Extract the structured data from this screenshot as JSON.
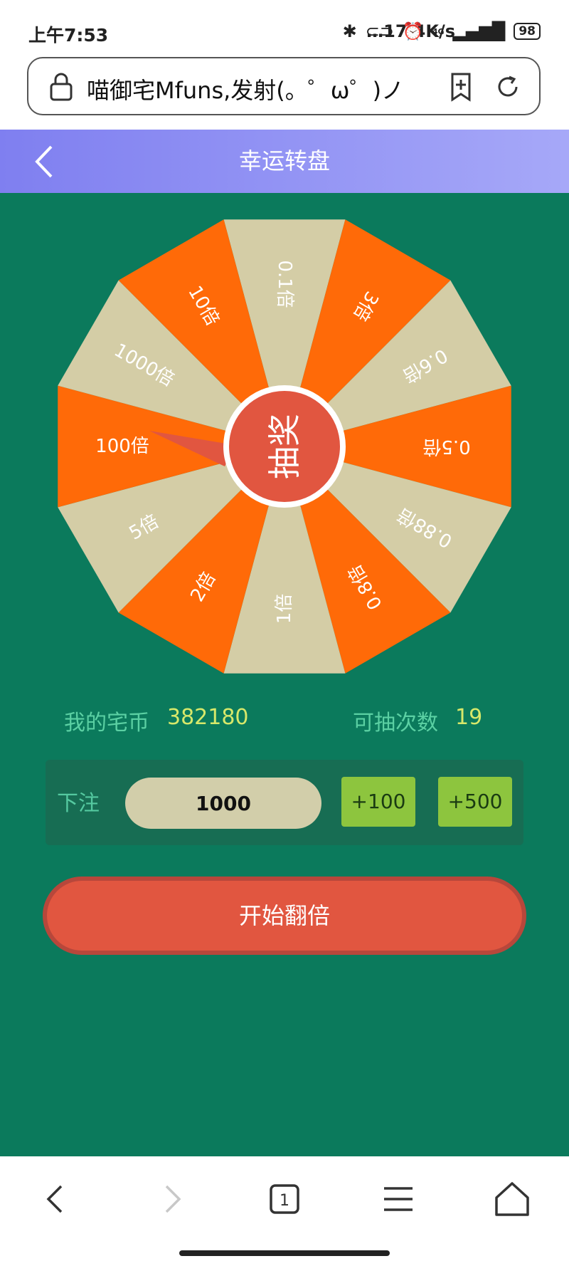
{
  "status_bar": {
    "time": "上午7:53",
    "speed": "…17.4K/s",
    "network": "4G",
    "battery": "98"
  },
  "browser": {
    "url_title": "喵御宅Mfuns,发射(。゜ω゜)ノ"
  },
  "header": {
    "title": "幸运转盘"
  },
  "wheel": {
    "center_label": "抽奖",
    "segments": [
      "0.1倍",
      "3倍",
      "0.6倍",
      "0.5倍",
      "0.88倍",
      "0.8倍",
      "1倍",
      "2倍",
      "5倍",
      "100倍",
      "1000倍",
      "10倍"
    ],
    "colors": {
      "orange": "#ff6a08",
      "beige": "#d4cda6",
      "center": "#e15640",
      "background": "#0b7a5c"
    }
  },
  "stats": {
    "coins_label": "我的宅币",
    "coins_value": "382180",
    "draws_label": "可抽次数",
    "draws_value": "19"
  },
  "bet": {
    "label": "下注",
    "value": "1000",
    "add100": "+100",
    "add500": "+500"
  },
  "start_button": {
    "label": "开始翻倍"
  }
}
